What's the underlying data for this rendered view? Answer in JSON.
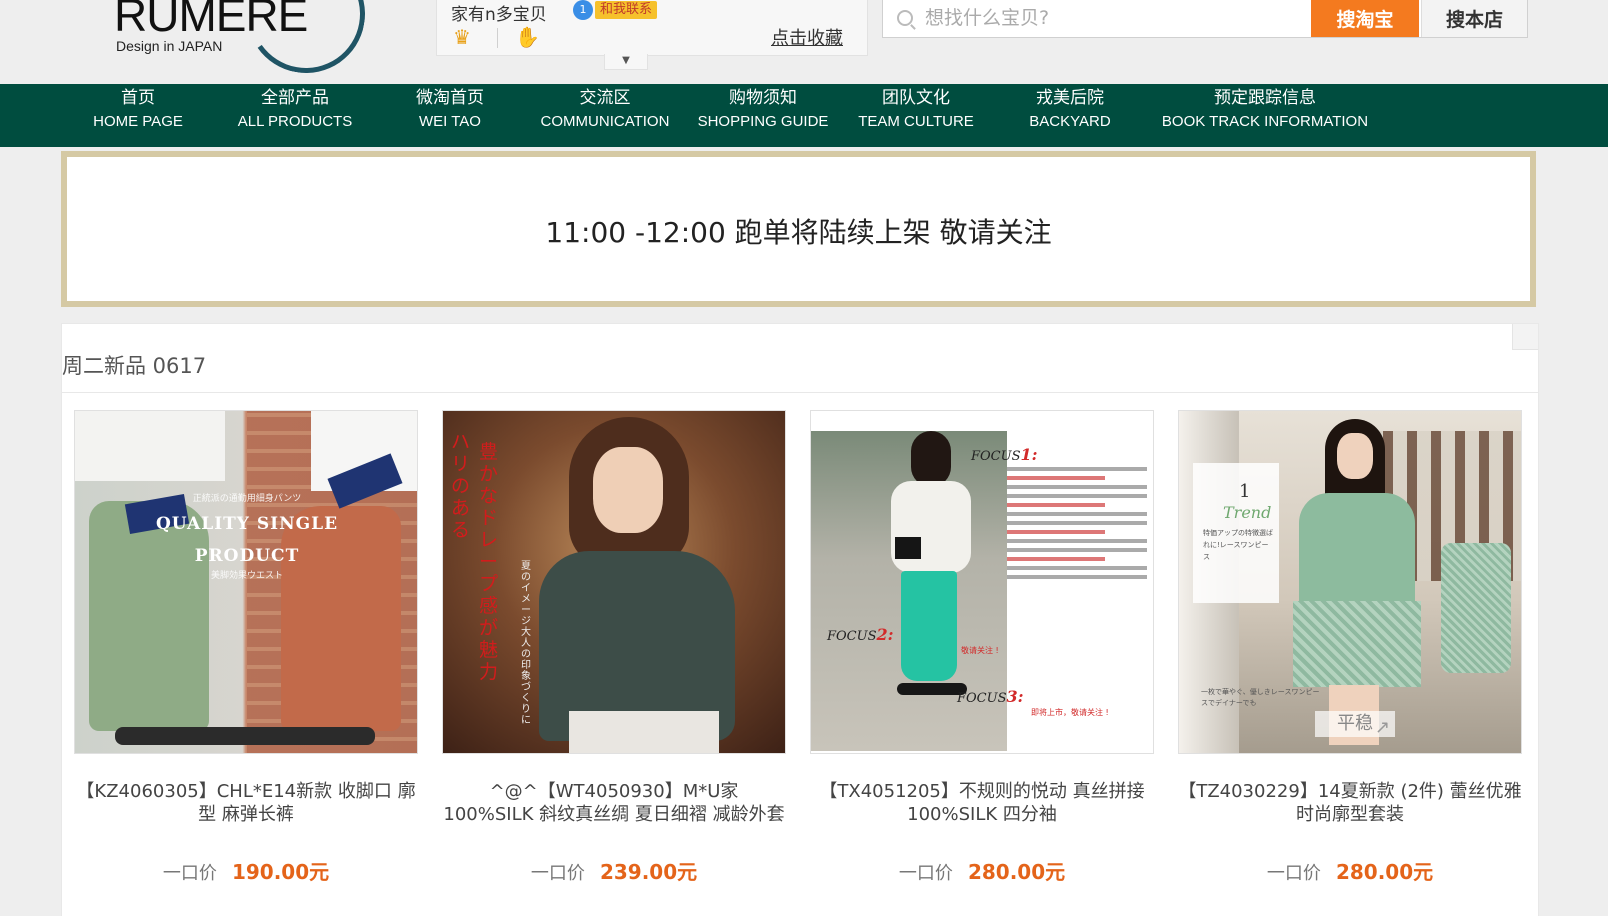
{
  "header": {
    "logo_text": "RUMERE",
    "logo_sub": "Design in JAPAN",
    "shop_name": "家有n多宝贝",
    "ww_count": "1",
    "ww_label": "和我联系",
    "favorite_link": "点击收藏",
    "search": {
      "placeholder": "想找什么宝贝?",
      "btn_taobao": "搜淘宝",
      "btn_shop": "搜本店"
    }
  },
  "nav": [
    {
      "cn": "首页",
      "en": "HOME PAGE"
    },
    {
      "cn": "全部产品",
      "en": "ALL PRODUCTS"
    },
    {
      "cn": "微淘首页",
      "en": "WEI TAO"
    },
    {
      "cn": "交流区",
      "en": "COMMUNICATION"
    },
    {
      "cn": "购物须知",
      "en": "SHOPPING GUIDE"
    },
    {
      "cn": "团队文化",
      "en": "TEAM CULTURE"
    },
    {
      "cn": "戎美后院",
      "en": "BACKYARD"
    },
    {
      "cn": "预定跟踪信息",
      "en": "BOOK TRACK INFORMATION"
    }
  ],
  "notice": "11:00 -12:00  跑单将陆续上架  敬请关注",
  "section_title": "周二新品 0617",
  "price_label": "一口价",
  "products": [
    {
      "name": "【KZ4060305】CHL*E14新款 收脚口 廓型 麻弹长裤",
      "price": "190.00元",
      "image_text": {
        "small_top": "正統派の通勤用細身パンツ",
        "big_line1": "QUALITY SINGLE",
        "big_line2": "PRODUCT",
        "small_bottom": "美脚効果ウエスト"
      }
    },
    {
      "name": "^@^【WT4050930】M*U家 100%SILK 斜纹真丝绸 夏日细褶 减龄外套",
      "price": "239.00元",
      "image_text": {
        "red_col1": "ハリのある",
        "red_col2": "豊かなドレープ感が魅力",
        "white_col": "夏のイメージ大人の印象づくりに"
      }
    },
    {
      "name": "【TX4051205】不规则的悦动 真丝拼接 100%SILK 四分袖",
      "price": "280.00元",
      "image_text": {
        "focus1": "FOCUS",
        "focus1_num": "1:",
        "focus2": "FOCUS",
        "focus2_num": "2:",
        "focus3": "FOCUS",
        "focus3_num": "3:",
        "caption1": "敬请关注 !",
        "caption2": "即将上市，敬请关注 !"
      }
    },
    {
      "name": "【TZ4030229】14夏新款 (2件) 蕾丝优雅 时尚廓型套装",
      "price": "280.00元",
      "image_text": {
        "trend_num": "1",
        "trend": "Trend",
        "trend_small": "特価アップの特徴選ばれに!レースワンピース",
        "jp_bottom": "一枚で華やぐ、優しきレースワンピースでデイナーでも",
        "stamp": "平稳"
      }
    }
  ],
  "colors": {
    "nav_bg": "#004d3f",
    "accent_orange": "#f47a1f",
    "price_orange": "#e4641a",
    "notice_border": "#d5c9a4"
  }
}
